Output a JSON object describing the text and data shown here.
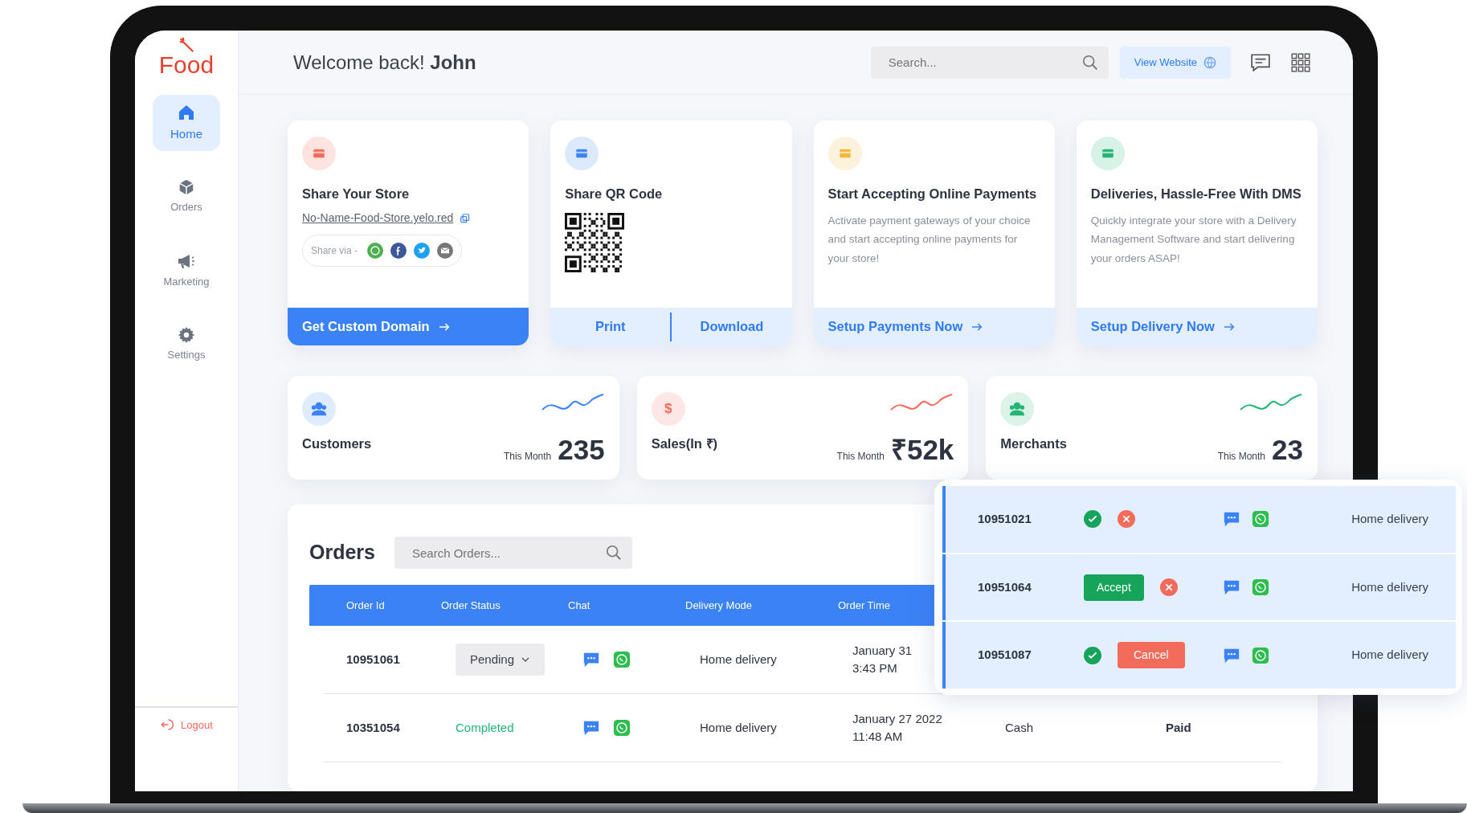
{
  "logo": {
    "text": "Food"
  },
  "sidebar": {
    "items": [
      {
        "label": "Home",
        "kind": "home",
        "selected": true
      },
      {
        "label": "Orders",
        "kind": "box",
        "selected": false
      },
      {
        "label": "Marketing",
        "kind": "megaphone",
        "selected": false
      },
      {
        "label": "Settings",
        "kind": "gear",
        "selected": false
      }
    ],
    "logout": "Logout"
  },
  "header": {
    "greeting": "Welcome back! **John**",
    "search": {
      "placeholder": "Search..."
    },
    "view_website": "View Website"
  },
  "action_cards": [
    {
      "kind": "share",
      "color": "#f26b5b",
      "title": "Share Your Store",
      "link": "No-Name-Food-Store.yelo.red",
      "share_label": "Share via -",
      "footer": [
        "Get Custom Domain"
      ]
    },
    {
      "kind": "qr",
      "color": "#3b82f6",
      "title": "Share QR Code",
      "footer": [
        "Print",
        "Download"
      ]
    },
    {
      "kind": "info",
      "color": "#f5b73b",
      "title": "Start Accepting Online Payments",
      "description": "Activate payment gateways of your choice and start accepting online payments for your store!",
      "footer": [
        "Setup Payments Now"
      ]
    },
    {
      "kind": "info",
      "color": "#22b573",
      "title": "Deliveries, Hassle-Free With DMS",
      "description": "Quickly integrate your store with a Delivery Management Software and start delivering your orders ASAP!",
      "footer": [
        "Setup Delivery Now"
      ]
    }
  ],
  "stats": [
    {
      "kind": "people",
      "color": "#3b82f6",
      "label": "Customers",
      "caption": "This Month",
      "value": "235"
    },
    {
      "kind": "symbol",
      "symbol": "$",
      "color": "#f26b5b",
      "label": "Sales(In ₹)",
      "caption": "This Month",
      "value": "₹52k"
    },
    {
      "kind": "people",
      "color": "#22b573",
      "label": "Merchants",
      "caption": "This Month",
      "value": "23"
    }
  ],
  "orders": {
    "title": "Orders",
    "search": {
      "placeholder": "Search Orders..."
    },
    "columns": [
      "Order Id",
      "Order Status",
      "Chat",
      "Delivery Mode",
      "Order Time"
    ],
    "rows": [
      {
        "order_id": "10951061",
        "status": {
          "kind": "dropdown",
          "text": "Pending"
        },
        "delivery_mode": "Home delivery",
        "order_time": [
          "January 31",
          "3:43 PM"
        ]
      },
      {
        "order_id": "10351054",
        "status": {
          "kind": "text",
          "text": "Completed"
        },
        "delivery_mode": "Home delivery",
        "order_time": [
          "January 27 2022",
          "11:48 AM"
        ],
        "column_6": "Cash",
        "column_7": "Paid"
      }
    ]
  },
  "new_orders": [
    {
      "order_id": "10951021",
      "actions": [
        {
          "kind": "accept_icon"
        },
        {
          "kind": "reject_icon"
        }
      ],
      "delivery_mode": "Home delivery"
    },
    {
      "order_id": "10951064",
      "actions": [
        {
          "kind": "accept_button",
          "label": "Accept"
        },
        {
          "kind": "reject_icon"
        }
      ],
      "delivery_mode": "Home delivery"
    },
    {
      "order_id": "10951087",
      "actions": [
        {
          "kind": "accept_icon"
        },
        {
          "kind": "cancel_button",
          "label": "Cancel"
        }
      ],
      "delivery_mode": "Home delivery"
    }
  ]
}
